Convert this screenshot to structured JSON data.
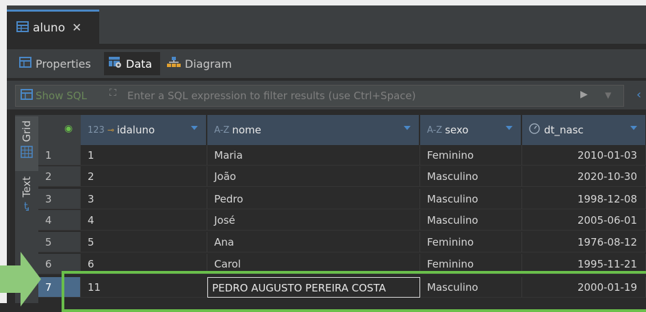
{
  "editor_tab": {
    "title": "aluno",
    "close": "✕"
  },
  "subtabs": [
    {
      "label": "Properties",
      "active": false
    },
    {
      "label": "Data",
      "active": true
    },
    {
      "label": "Diagram",
      "active": false
    }
  ],
  "filter": {
    "show_sql": "Show SQL",
    "placeholder": "Enter a SQL expression to filter results (use Ctrl+Space)"
  },
  "side_tabs": {
    "grid": "Grid",
    "text": "Text"
  },
  "columns": [
    {
      "type": "123",
      "name": "idaluno"
    },
    {
      "type": "A-Z",
      "name": "nome"
    },
    {
      "type": "A-Z",
      "name": "sexo"
    },
    {
      "type": "clock",
      "name": "dt_nasc"
    }
  ],
  "rows": [
    {
      "n": "1",
      "idaluno": "1",
      "nome": "Maria",
      "sexo": "Feminino",
      "dt_nasc": "2010-01-03"
    },
    {
      "n": "2",
      "idaluno": "2",
      "nome": "João",
      "sexo": "Masculino",
      "dt_nasc": "2020-10-30"
    },
    {
      "n": "3",
      "idaluno": "3",
      "nome": "Pedro",
      "sexo": "Masculino",
      "dt_nasc": "1998-12-08"
    },
    {
      "n": "4",
      "idaluno": "4",
      "nome": "José",
      "sexo": "Masculino",
      "dt_nasc": "2005-06-01"
    },
    {
      "n": "5",
      "idaluno": "5",
      "nome": "Ana",
      "sexo": "Feminino",
      "dt_nasc": "1976-08-12"
    },
    {
      "n": "6",
      "idaluno": "6",
      "nome": "Carol",
      "sexo": "Feminino",
      "dt_nasc": "1995-11-21"
    },
    {
      "n": "7",
      "idaluno": "11",
      "nome": "PEDRO AUGUSTO PEREIRA COSTA",
      "sexo": "Masculino",
      "dt_nasc": "2000-01-19"
    }
  ],
  "colors": {
    "highlight": "#6abf4b",
    "accent": "#4a88c7"
  }
}
